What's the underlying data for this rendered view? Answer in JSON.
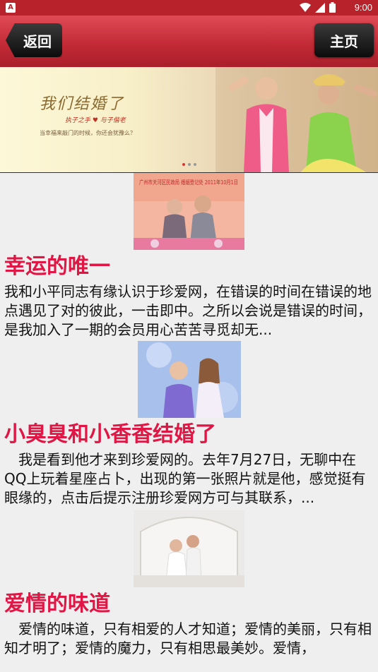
{
  "status_bar": {
    "app_badge": "A",
    "time": "9:00"
  },
  "header": {
    "back_label": "返回",
    "home_label": "主页"
  },
  "banner": {
    "title": "我们结婚了",
    "subtitle": "执子之手 ♥ 与子偕老",
    "tagline": "当幸福来敲门的时候，你还会犹豫么？"
  },
  "articles": [
    {
      "title": "幸运的唯一",
      "excerpt": "我和小平同志有缘认识于珍爱网，在错误的时间在错误的地点遇见了对的彼此，一击即中。之所以会说是错误的时间，是我加入了一期的会员用心苦苦寻觅却无...",
      "photo_caption": "广州市天河区民政局 婚姻登记处 2011年10月1日"
    },
    {
      "title": "小臭臭和小香香结婚了",
      "excerpt": "　我是看到他才来到珍爱网的。去年7月27日，无聊中在QQ上玩着星座占卜，出现的第一张照片就是他，感觉挺有眼缘的，点击后提示注册珍爱网方可与其联系，..."
    },
    {
      "title": "爱情的味道",
      "excerpt": "　爱情的味道，只有相爱的人才知道；爱情的美丽，只有相知才明了；爱情的魔力，只有相思最美妙。爱情，"
    }
  ]
}
